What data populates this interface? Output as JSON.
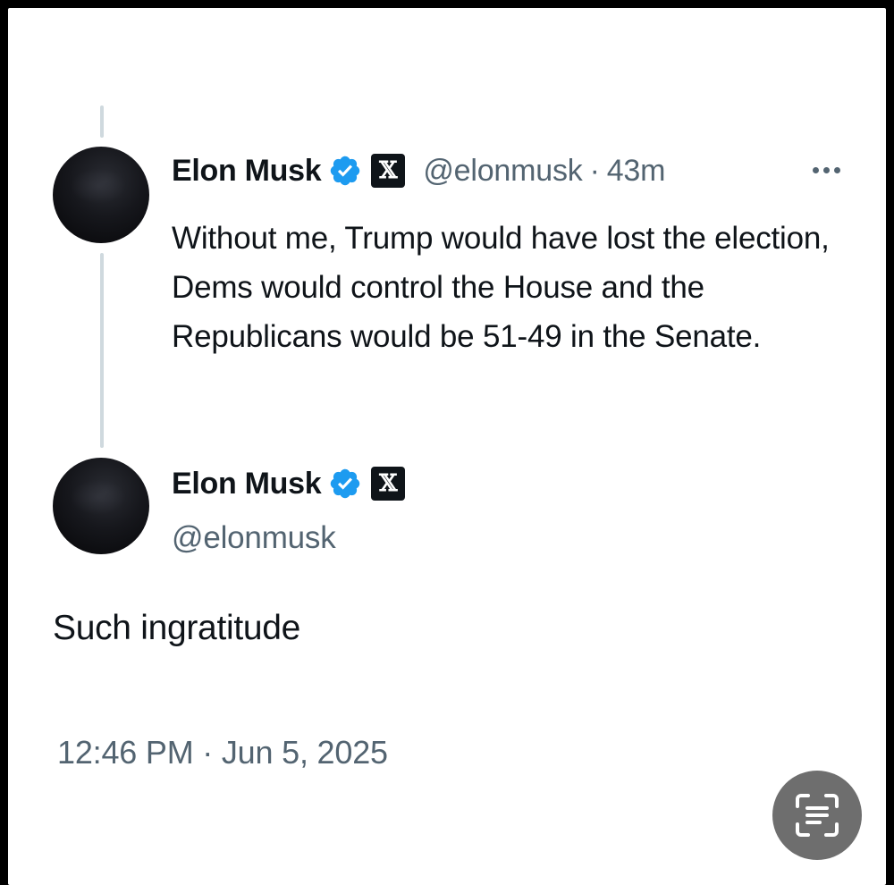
{
  "reply_context": {
    "author_name": "Elon Musk",
    "handle": "@elonmusk",
    "separator": "·",
    "time_ago": "43m",
    "text": "Without me, Trump would have lost the election, Dems would control the House and the Republicans would be 51-49 in the Senate.",
    "verified_icon": "verified-badge-icon",
    "affiliate_icon": "x-logo-icon",
    "more_icon": "more-options-icon"
  },
  "main_post": {
    "author_name": "Elon Musk",
    "handle": "@elonmusk",
    "text": "Such ingratitude",
    "timestamp": "12:46 PM · Jun 5, 2025",
    "verified_icon": "verified-badge-icon",
    "affiliate_icon": "x-logo-icon"
  },
  "overlay": {
    "scan_icon": "text-scan-icon"
  },
  "colors": {
    "verified_blue": "#1d9bf0",
    "text_primary": "#0f1419",
    "text_secondary": "#536471",
    "thread_line": "#cfd9de",
    "scan_button_bg": "#6e6e6e"
  }
}
